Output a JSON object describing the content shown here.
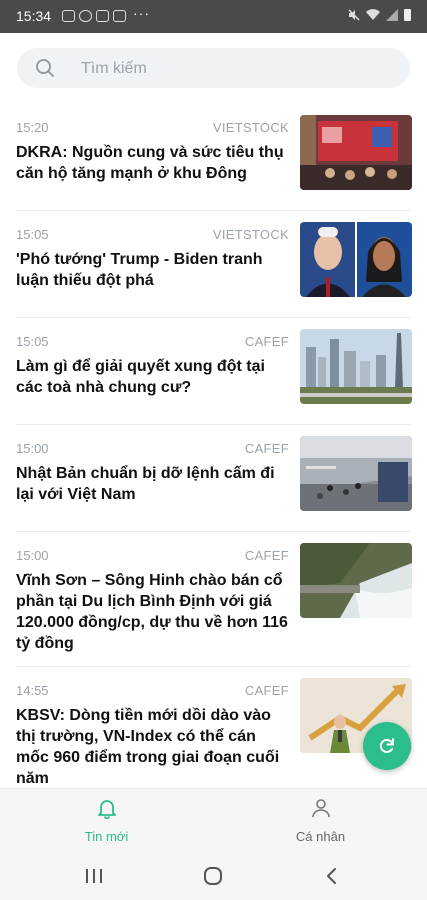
{
  "status_bar": {
    "time": "15:34",
    "dots": "···"
  },
  "search": {
    "placeholder": "Tìm kiếm"
  },
  "articles": [
    {
      "time": "15:20",
      "source": "VIETSTOCK",
      "title": "DKRA: Nguồn cung và sức tiêu thụ căn hộ tăng mạnh ở khu Đông",
      "thumb": "conference"
    },
    {
      "time": "15:05",
      "source": "VIETSTOCK",
      "title": "'Phó tướng' Trump - Biden tranh luận thiếu đột phá",
      "thumb": "portraits"
    },
    {
      "time": "15:05",
      "source": "CAFEF",
      "title": "Làm gì để giải quyết xung đột tại các toà nhà chung cư?",
      "thumb": "city"
    },
    {
      "time": "15:00",
      "source": "CAFEF",
      "title": "Nhật Bản chuẩn bị dỡ lệnh cấm đi lại với Việt Nam",
      "thumb": "airport"
    },
    {
      "time": "15:00",
      "source": "CAFEF",
      "title": "Vĩnh Sơn – Sông Hinh chào bán cổ phần tại Du lịch Bình Định với giá 120.000 đồng/cp, dự thu về hơn 116 tỷ đồng",
      "thumb": "dam"
    },
    {
      "time": "14:55",
      "source": "CAFEF",
      "title": "KBSV: Dòng tiền mới dồi dào vào thị trường, VN-Index có thể cán mốc 960 điểm trong giai đoạn cuối năm",
      "thumb": "chart"
    }
  ],
  "tabs": [
    {
      "label": "Tin mới",
      "icon": "bell-icon",
      "active": true
    },
    {
      "label": "Cá nhân",
      "icon": "person-icon",
      "active": false
    }
  ],
  "colors": {
    "accent": "#2bbd8a",
    "status_bar": "#4a4a4a"
  }
}
